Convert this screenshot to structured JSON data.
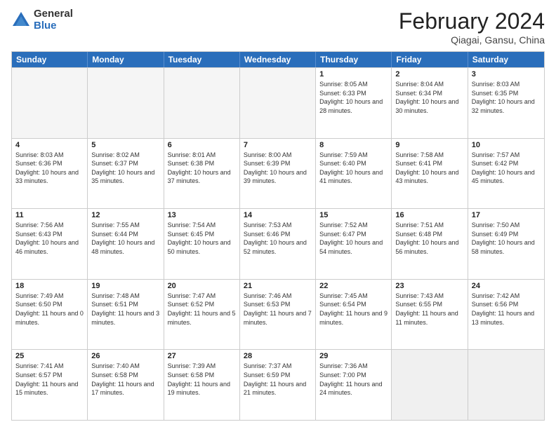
{
  "header": {
    "logo_general": "General",
    "logo_blue": "Blue",
    "title": "February 2024",
    "location": "Qiagai, Gansu, China"
  },
  "days_of_week": [
    "Sunday",
    "Monday",
    "Tuesday",
    "Wednesday",
    "Thursday",
    "Friday",
    "Saturday"
  ],
  "rows": [
    [
      {
        "day": "",
        "empty": true
      },
      {
        "day": "",
        "empty": true
      },
      {
        "day": "",
        "empty": true
      },
      {
        "day": "",
        "empty": true
      },
      {
        "day": "1",
        "sunrise": "Sunrise: 8:05 AM",
        "sunset": "Sunset: 6:33 PM",
        "daylight": "Daylight: 10 hours and 28 minutes."
      },
      {
        "day": "2",
        "sunrise": "Sunrise: 8:04 AM",
        "sunset": "Sunset: 6:34 PM",
        "daylight": "Daylight: 10 hours and 30 minutes."
      },
      {
        "day": "3",
        "sunrise": "Sunrise: 8:03 AM",
        "sunset": "Sunset: 6:35 PM",
        "daylight": "Daylight: 10 hours and 32 minutes."
      }
    ],
    [
      {
        "day": "4",
        "sunrise": "Sunrise: 8:03 AM",
        "sunset": "Sunset: 6:36 PM",
        "daylight": "Daylight: 10 hours and 33 minutes."
      },
      {
        "day": "5",
        "sunrise": "Sunrise: 8:02 AM",
        "sunset": "Sunset: 6:37 PM",
        "daylight": "Daylight: 10 hours and 35 minutes."
      },
      {
        "day": "6",
        "sunrise": "Sunrise: 8:01 AM",
        "sunset": "Sunset: 6:38 PM",
        "daylight": "Daylight: 10 hours and 37 minutes."
      },
      {
        "day": "7",
        "sunrise": "Sunrise: 8:00 AM",
        "sunset": "Sunset: 6:39 PM",
        "daylight": "Daylight: 10 hours and 39 minutes."
      },
      {
        "day": "8",
        "sunrise": "Sunrise: 7:59 AM",
        "sunset": "Sunset: 6:40 PM",
        "daylight": "Daylight: 10 hours and 41 minutes."
      },
      {
        "day": "9",
        "sunrise": "Sunrise: 7:58 AM",
        "sunset": "Sunset: 6:41 PM",
        "daylight": "Daylight: 10 hours and 43 minutes."
      },
      {
        "day": "10",
        "sunrise": "Sunrise: 7:57 AM",
        "sunset": "Sunset: 6:42 PM",
        "daylight": "Daylight: 10 hours and 45 minutes."
      }
    ],
    [
      {
        "day": "11",
        "sunrise": "Sunrise: 7:56 AM",
        "sunset": "Sunset: 6:43 PM",
        "daylight": "Daylight: 10 hours and 46 minutes."
      },
      {
        "day": "12",
        "sunrise": "Sunrise: 7:55 AM",
        "sunset": "Sunset: 6:44 PM",
        "daylight": "Daylight: 10 hours and 48 minutes."
      },
      {
        "day": "13",
        "sunrise": "Sunrise: 7:54 AM",
        "sunset": "Sunset: 6:45 PM",
        "daylight": "Daylight: 10 hours and 50 minutes."
      },
      {
        "day": "14",
        "sunrise": "Sunrise: 7:53 AM",
        "sunset": "Sunset: 6:46 PM",
        "daylight": "Daylight: 10 hours and 52 minutes."
      },
      {
        "day": "15",
        "sunrise": "Sunrise: 7:52 AM",
        "sunset": "Sunset: 6:47 PM",
        "daylight": "Daylight: 10 hours and 54 minutes."
      },
      {
        "day": "16",
        "sunrise": "Sunrise: 7:51 AM",
        "sunset": "Sunset: 6:48 PM",
        "daylight": "Daylight: 10 hours and 56 minutes."
      },
      {
        "day": "17",
        "sunrise": "Sunrise: 7:50 AM",
        "sunset": "Sunset: 6:49 PM",
        "daylight": "Daylight: 10 hours and 58 minutes."
      }
    ],
    [
      {
        "day": "18",
        "sunrise": "Sunrise: 7:49 AM",
        "sunset": "Sunset: 6:50 PM",
        "daylight": "Daylight: 11 hours and 0 minutes."
      },
      {
        "day": "19",
        "sunrise": "Sunrise: 7:48 AM",
        "sunset": "Sunset: 6:51 PM",
        "daylight": "Daylight: 11 hours and 3 minutes."
      },
      {
        "day": "20",
        "sunrise": "Sunrise: 7:47 AM",
        "sunset": "Sunset: 6:52 PM",
        "daylight": "Daylight: 11 hours and 5 minutes."
      },
      {
        "day": "21",
        "sunrise": "Sunrise: 7:46 AM",
        "sunset": "Sunset: 6:53 PM",
        "daylight": "Daylight: 11 hours and 7 minutes."
      },
      {
        "day": "22",
        "sunrise": "Sunrise: 7:45 AM",
        "sunset": "Sunset: 6:54 PM",
        "daylight": "Daylight: 11 hours and 9 minutes."
      },
      {
        "day": "23",
        "sunrise": "Sunrise: 7:43 AM",
        "sunset": "Sunset: 6:55 PM",
        "daylight": "Daylight: 11 hours and 11 minutes."
      },
      {
        "day": "24",
        "sunrise": "Sunrise: 7:42 AM",
        "sunset": "Sunset: 6:56 PM",
        "daylight": "Daylight: 11 hours and 13 minutes."
      }
    ],
    [
      {
        "day": "25",
        "sunrise": "Sunrise: 7:41 AM",
        "sunset": "Sunset: 6:57 PM",
        "daylight": "Daylight: 11 hours and 15 minutes."
      },
      {
        "day": "26",
        "sunrise": "Sunrise: 7:40 AM",
        "sunset": "Sunset: 6:58 PM",
        "daylight": "Daylight: 11 hours and 17 minutes."
      },
      {
        "day": "27",
        "sunrise": "Sunrise: 7:39 AM",
        "sunset": "Sunset: 6:58 PM",
        "daylight": "Daylight: 11 hours and 19 minutes."
      },
      {
        "day": "28",
        "sunrise": "Sunrise: 7:37 AM",
        "sunset": "Sunset: 6:59 PM",
        "daylight": "Daylight: 11 hours and 21 minutes."
      },
      {
        "day": "29",
        "sunrise": "Sunrise: 7:36 AM",
        "sunset": "Sunset: 7:00 PM",
        "daylight": "Daylight: 11 hours and 24 minutes."
      },
      {
        "day": "",
        "empty": true,
        "shaded": true
      },
      {
        "day": "",
        "empty": true,
        "shaded": true
      }
    ]
  ]
}
